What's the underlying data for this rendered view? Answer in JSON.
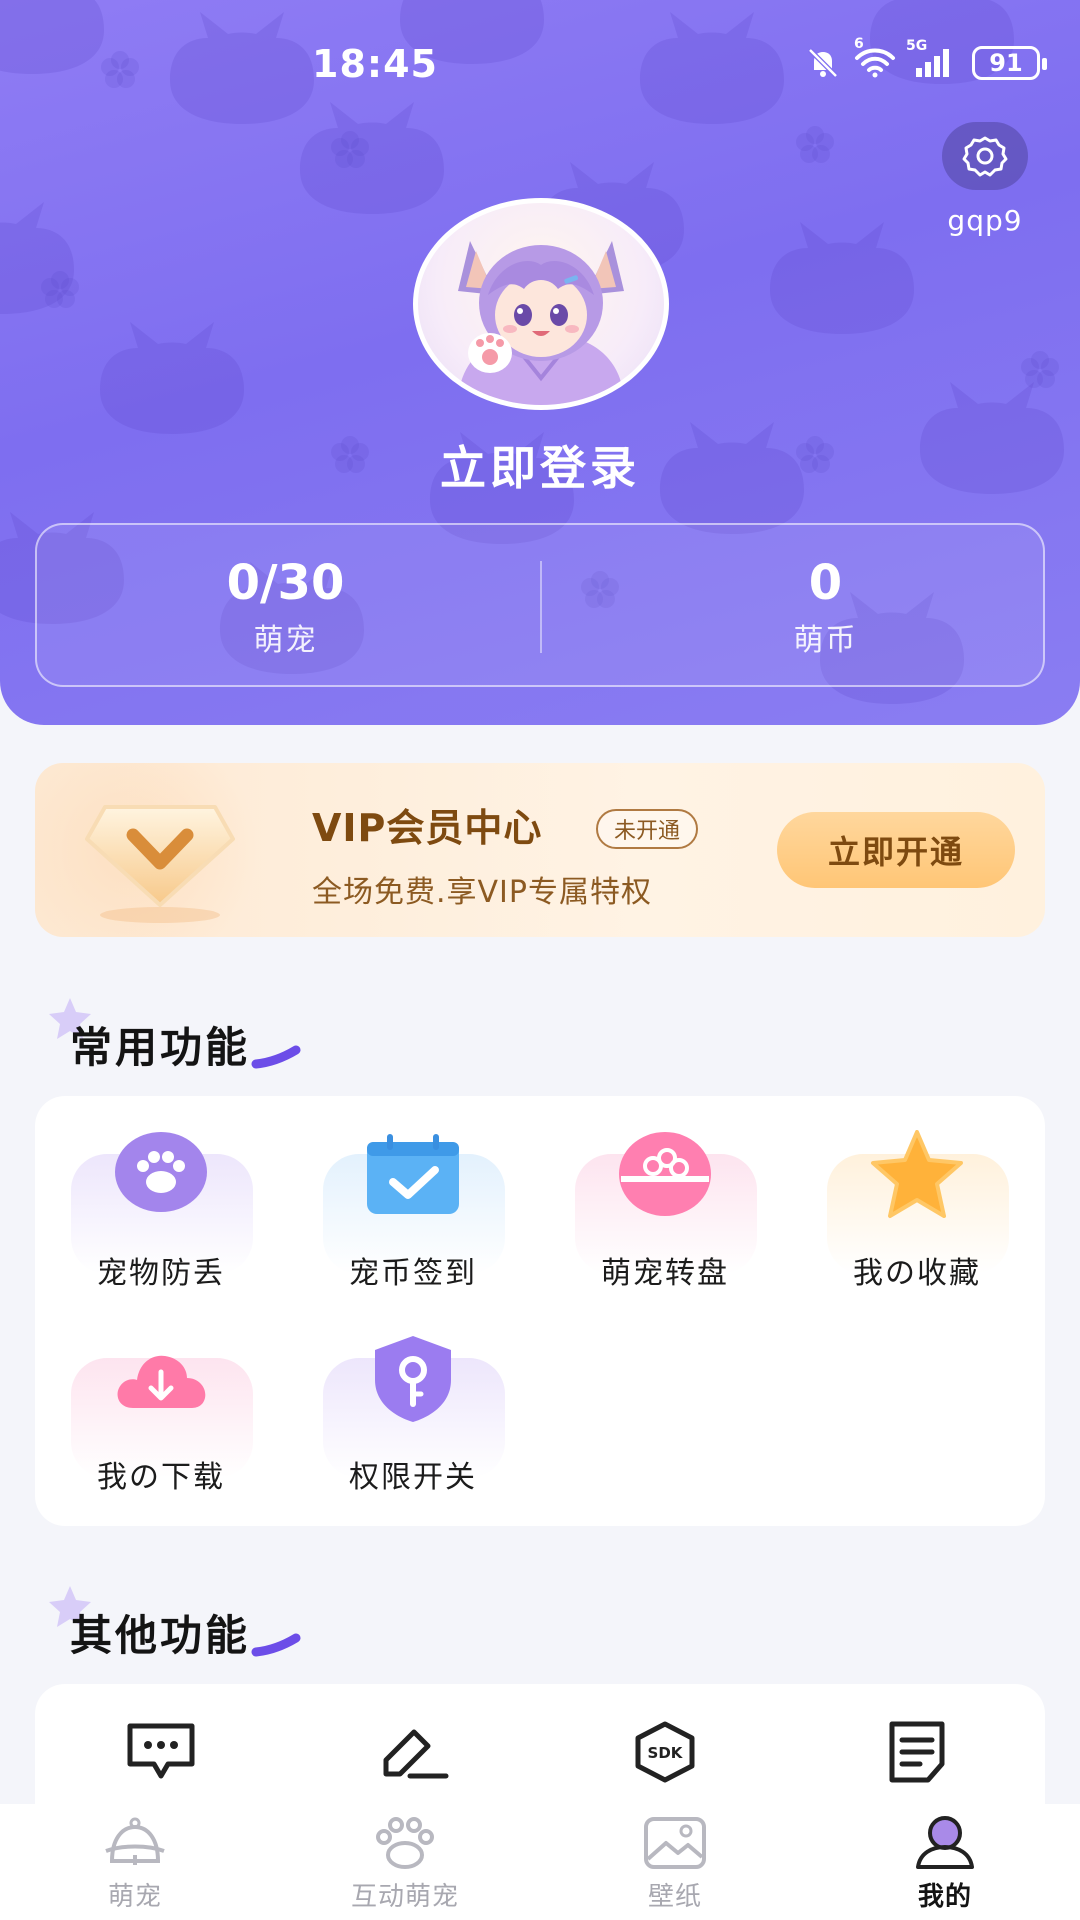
{
  "status_bar": {
    "time": "18:45",
    "network_badge": "6",
    "signal_badge": "5G",
    "battery": "91"
  },
  "header": {
    "settings_label": "gqp9",
    "login_text": "立即登录",
    "stats": [
      {
        "value": "0/30",
        "label": "萌宠"
      },
      {
        "value": "0",
        "label": "萌币"
      }
    ]
  },
  "vip": {
    "title": "VIP会员中心",
    "status": "未开通",
    "description": "全场免费.享VIP专属特权",
    "button": "立即开通"
  },
  "common": {
    "title": "常用功能",
    "items": [
      {
        "label": "宠物防丢",
        "icon": "paw-icon"
      },
      {
        "label": "宠币签到",
        "icon": "calendar-check-icon"
      },
      {
        "label": "萌宠转盘",
        "icon": "wheel-icon"
      },
      {
        "label": "我の收藏",
        "icon": "star-icon"
      },
      {
        "label": "我の下载",
        "icon": "cloud-download-icon"
      },
      {
        "label": "权限开关",
        "icon": "shield-key-icon"
      }
    ]
  },
  "other": {
    "title": "其他功能",
    "items": [
      {
        "icon": "message-icon"
      },
      {
        "icon": "edit-icon"
      },
      {
        "icon": "sdk-icon",
        "text": "SDK"
      },
      {
        "icon": "document-icon"
      }
    ]
  },
  "nav": {
    "items": [
      {
        "label": "萌宠",
        "icon": "pet-bell-icon"
      },
      {
        "label": "互动萌宠",
        "icon": "paw-icon"
      },
      {
        "label": "壁纸",
        "icon": "wallpaper-icon"
      },
      {
        "label": "我的",
        "icon": "profile-icon",
        "active": true
      }
    ]
  },
  "colors": {
    "header_purple": "#7e6ef0",
    "vip_gold": "#7e4a10",
    "vip_button": "#ffc676",
    "accent_purple": "#9b7cf0",
    "accent_pink": "#ff6fa5",
    "accent_blue": "#4aa8f5",
    "accent_orange": "#ffb23a"
  }
}
